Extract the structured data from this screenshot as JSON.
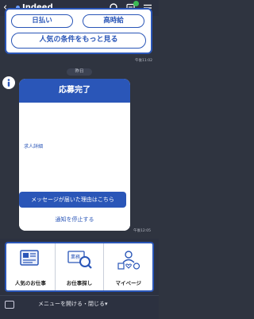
{
  "header": {
    "back_icon": "chevron-left-icon",
    "title": "Indeed",
    "icons": [
      "search-icon",
      "document-icon",
      "menu-icon"
    ]
  },
  "previous_card": {
    "pill_left": "日払い",
    "pill_right": "高時給",
    "more_button": "人気の条件をもっと見る",
    "timestamp": "午後11:02"
  },
  "divider": {
    "label": "昨日"
  },
  "card": {
    "header": "応募完了",
    "job_detail_label": "求人詳細",
    "message_button": "メッセージが届いた理由はこちら",
    "stop_link": "通知を停止する",
    "timestamp": "午後12:05"
  },
  "bottom_menu": {
    "items": [
      {
        "label": "人気のお仕事",
        "icon": "job-list-icon"
      },
      {
        "label": "お仕事探し",
        "icon": "search-job-icon",
        "icon_text": "業務"
      },
      {
        "label": "マイページ",
        "icon": "mypage-icon"
      }
    ]
  },
  "footer": {
    "label": "メニューを開ける・閉じる▾"
  },
  "colors": {
    "accent": "#2a56b8",
    "background": "#2f3440"
  }
}
